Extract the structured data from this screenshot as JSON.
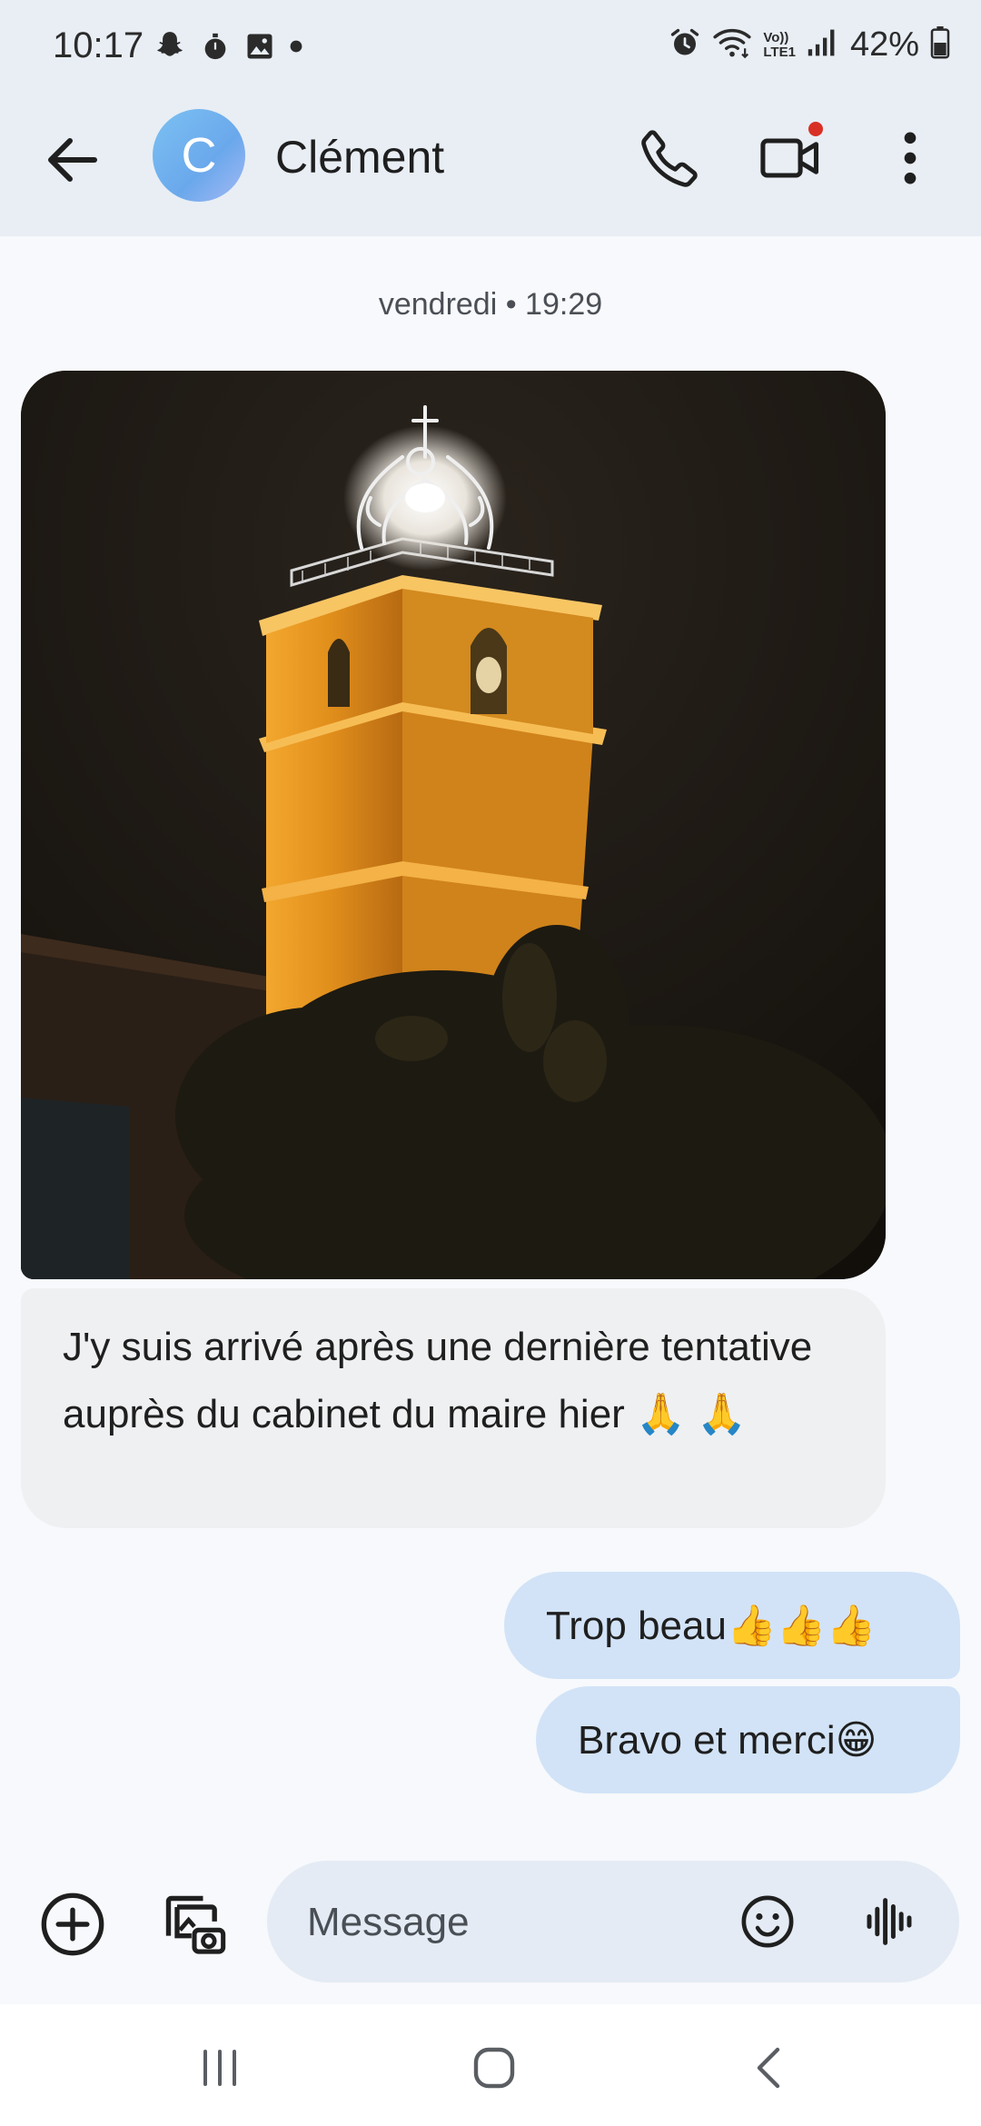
{
  "status_bar": {
    "time": "10:17",
    "battery": "42%",
    "notification_icons": [
      "snapchat-icon",
      "timer-icon",
      "gallery-icon",
      "dot-icon"
    ],
    "system_icons": [
      "alarm-icon",
      "wifi-icon",
      "volte-icon",
      "signal-icon",
      "battery-icon"
    ],
    "volte_label": "Vo))",
    "lte_label": "LTE1"
  },
  "header": {
    "contact_initial": "C",
    "contact_name": "Clément",
    "avatar_color": "#7cc1f2",
    "video_badge_color": "#d93025"
  },
  "conversation": {
    "timestamp": "vendredi • 19:29",
    "received": [
      {
        "type": "image",
        "description": "illuminated bell tower at night"
      },
      {
        "type": "text",
        "text": "J'y suis arrivé après une dernière tentative auprès du cabinet du maire hier 🙏 🙏"
      }
    ],
    "sent": [
      {
        "text": "Trop beau👍👍👍"
      },
      {
        "text": "Bravo et merci😁"
      }
    ],
    "sent_bubble_color": "#d2e3f7",
    "received_bubble_color": "#eff0f2"
  },
  "composer": {
    "placeholder": "Message"
  },
  "colors": {
    "header_background": "#e8eef4",
    "page_background": "#f7f9fc"
  }
}
